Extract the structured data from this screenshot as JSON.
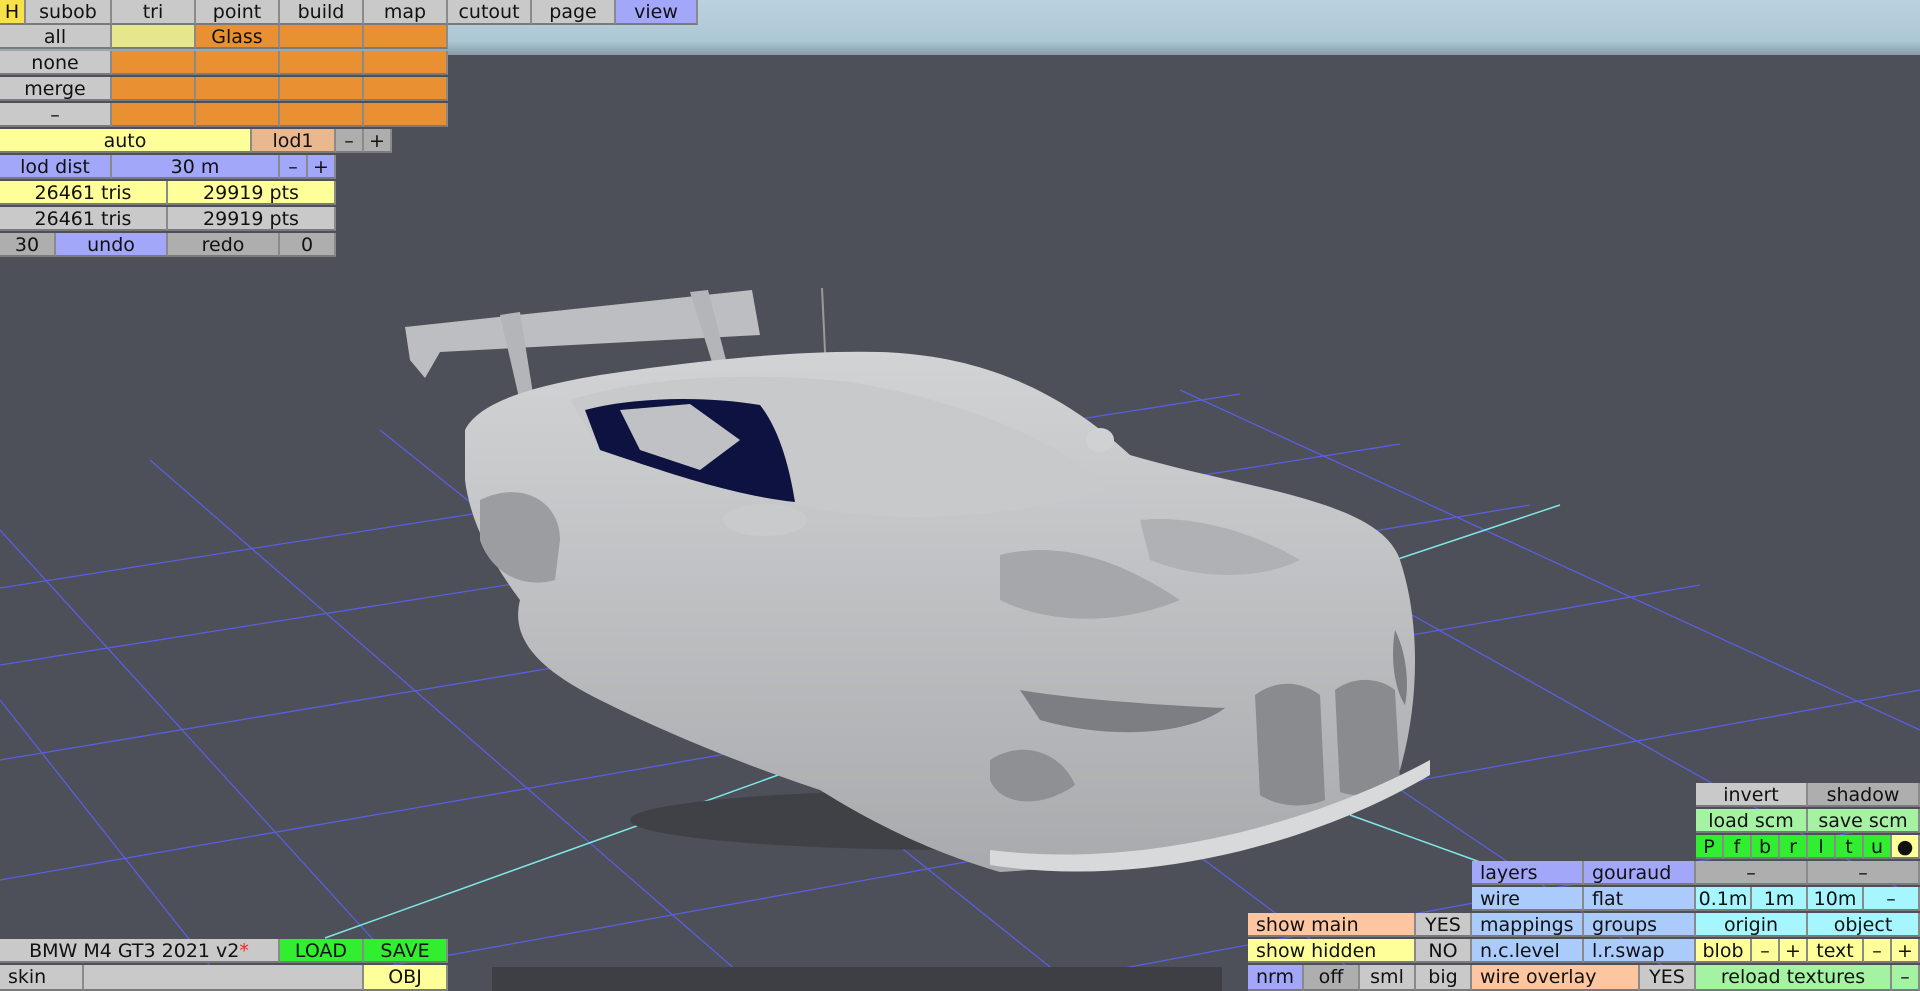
{
  "tabs": [
    "H",
    "subob",
    "tri",
    "point",
    "build",
    "map",
    "cutout",
    "page",
    "view"
  ],
  "subob": {
    "all": "all",
    "none": "none",
    "merge": "merge",
    "dash": "–",
    "slot1": "Glass"
  },
  "lod": {
    "mode": "auto",
    "level": "lod1",
    "minus": "–",
    "plus": "+",
    "dist_label": "lod dist",
    "dist_value": "30 m"
  },
  "stats": {
    "row1_tris": "26461 tris",
    "row1_pts": "29919 pts",
    "row2_tris": "26461 tris",
    "row2_pts": "29919 pts"
  },
  "history": {
    "undo_count": "30",
    "undo": "undo",
    "redo": "redo",
    "redo_count": "0"
  },
  "file": {
    "name": "BMW M4 GT3 2021 v2",
    "modified_mark": "*",
    "load": "LOAD",
    "save": "SAVE",
    "skin": "skin",
    "obj": "OBJ"
  },
  "display": {
    "show_main": "show main",
    "show_main_val": "YES",
    "show_hidden": "show hidden",
    "show_hidden_val": "NO",
    "nrm": "nrm",
    "off": "off",
    "sml": "sml",
    "big": "big"
  },
  "render": {
    "layers": "layers",
    "gouraud": "gouraud",
    "wire": "wire",
    "flat": "flat",
    "mappings": "mappings",
    "groups": "groups",
    "nclevel": "n.c.level",
    "lrswap": "l.r.swap",
    "wire_overlay": "wire overlay",
    "wire_overlay_val": "YES"
  },
  "scene": {
    "invert": "invert",
    "shadow": "shadow",
    "load_scm": "load scm",
    "save_scm": "save scm",
    "views": [
      "P",
      "f",
      "b",
      "r",
      "l",
      "t",
      "u",
      "●"
    ],
    "dash1": "–",
    "dash2": "–",
    "grid": [
      "0.1m",
      "1m",
      "10m",
      "–"
    ],
    "origin": "origin",
    "object": "object",
    "blob": "blob",
    "blob_minus": "–",
    "blob_plus": "+",
    "text": "text",
    "text_minus": "–",
    "text_plus": "+",
    "reload": "reload textures",
    "reload_dash": "–"
  },
  "colors": {
    "background": "#4d5058",
    "grid_line": "#5a5ee0",
    "axis_line": "#7fe8e8",
    "car_body": "#c3c4c6",
    "glass": "#0e1240"
  }
}
